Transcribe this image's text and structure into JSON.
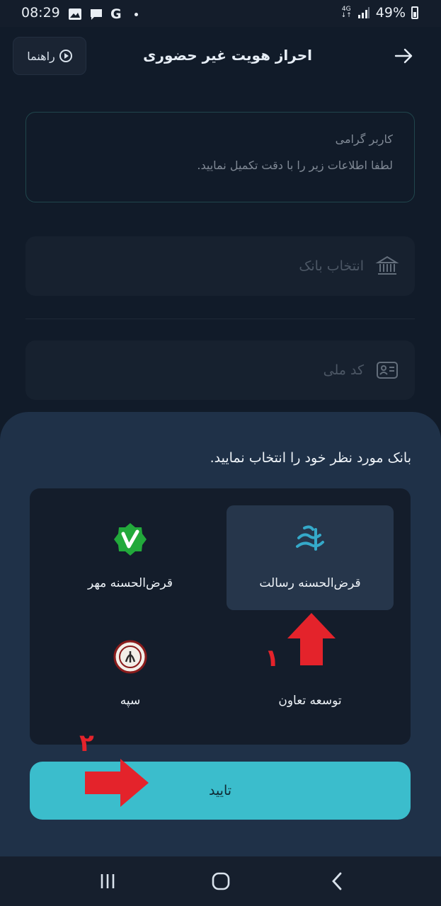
{
  "status_bar": {
    "time": "08:29",
    "network": "4G",
    "battery": "49%",
    "icons": [
      "gallery-icon",
      "message-icon",
      "google-icon",
      "signal-icon",
      "battery-icon"
    ]
  },
  "header": {
    "title": "احراز هویت غیر حضوری",
    "help_label": "راهنما"
  },
  "notice": {
    "line1": "کاربر گرامی",
    "line2": "لطفا اطلاعات زیر را با دقت تکمیل نمایید."
  },
  "form": {
    "bank_placeholder": "انتخاب بانک",
    "national_code_placeholder": "کد ملی"
  },
  "sheet": {
    "title": "بانک مورد نظر خود را انتخاب نمایید.",
    "banks": [
      {
        "name": "قرض‌الحسنه رسالت",
        "selected": true
      },
      {
        "name": "قرض‌الحسنه مهر",
        "selected": false
      },
      {
        "name": "توسعه تعاون",
        "selected": false
      },
      {
        "name": "سپه",
        "selected": false
      }
    ],
    "confirm_label": "تایید"
  },
  "annotations": {
    "step1": "۱",
    "step2": "۲",
    "color": "#e4232b"
  },
  "colors": {
    "background": "#111b29",
    "sheet": "#1f3148",
    "accent": "#3bbdcc",
    "selected_bank": "#26364b"
  }
}
